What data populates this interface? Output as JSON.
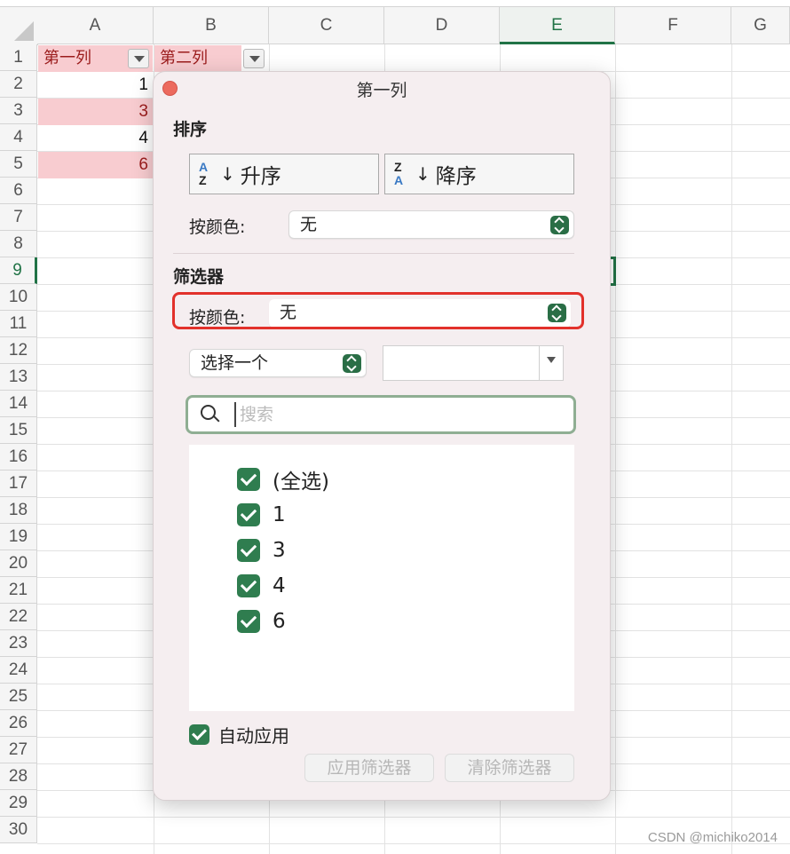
{
  "sheet": {
    "columns": [
      "A",
      "B",
      "C",
      "D",
      "E",
      "F",
      "G"
    ],
    "rows": [
      "1",
      "2",
      "3",
      "4",
      "5",
      "6",
      "7",
      "8",
      "9",
      "10",
      "11",
      "12",
      "13",
      "14",
      "15",
      "16",
      "17",
      "18",
      "19",
      "20",
      "21",
      "22",
      "23",
      "24",
      "25",
      "26",
      "27",
      "28",
      "29",
      "30"
    ],
    "active_column": "E",
    "active_row": "9",
    "header_cells": [
      "第一列",
      "第二列"
    ],
    "column_a_values": [
      "1",
      "3",
      "4",
      "6"
    ],
    "watermark": "CSDN @michiko2014",
    "colors": {
      "accent": "#217346",
      "filtered_fill": "#f8ccd0",
      "filtered_text": "#9b1c1c"
    }
  },
  "popover": {
    "title": "第一列",
    "sort_section": "排序",
    "sort_asc": "升序",
    "sort_desc": "降序",
    "sort_by_color_label": "按颜色:",
    "sort_by_color_value": "无",
    "filter_section": "筛选器",
    "filter_by_color_label": "按颜色:",
    "filter_by_color_value": "无",
    "choose_one": "选择一个",
    "search_placeholder": "搜索",
    "items": [
      "(全选)",
      "1",
      "3",
      "4",
      "6"
    ],
    "auto_apply": "自动应用",
    "apply_button": "应用筛选器",
    "clear_button": "清除筛选器",
    "icons": {
      "close": "close-dot-icon",
      "asc": "sort-az-icon",
      "desc": "sort-za-icon",
      "search": "search-icon",
      "stepper": "stepper-icon"
    }
  }
}
